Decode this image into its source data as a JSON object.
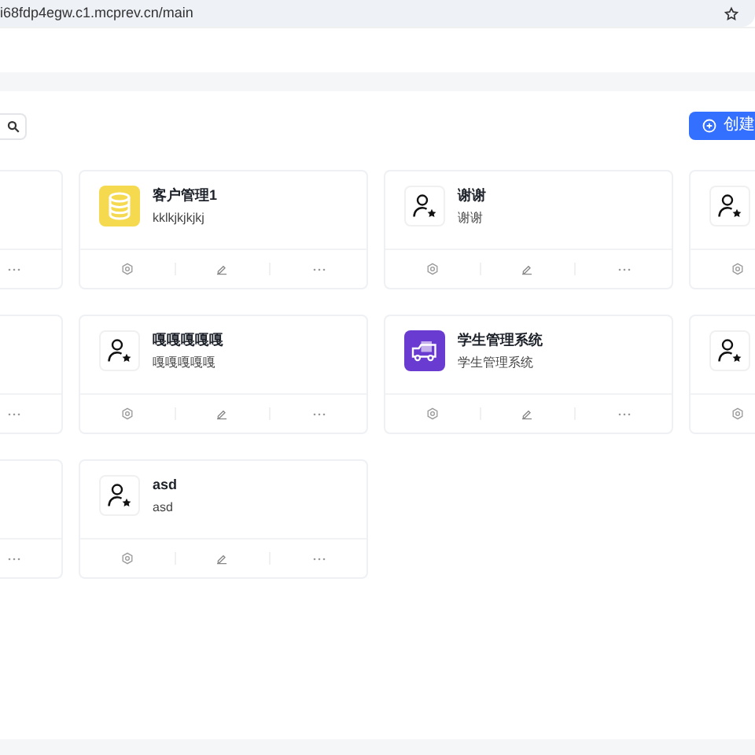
{
  "browser": {
    "url": "i68fdp4egw.c1.mcprev.cn/main"
  },
  "toolbar": {
    "create_button": "创建"
  },
  "cards": [
    {
      "kind": "blank"
    },
    {
      "kind": "database",
      "title": "客户管理1",
      "description": "kklkjkjkjkj"
    },
    {
      "kind": "user",
      "title": "谢谢",
      "description": "谢谢"
    },
    {
      "kind": "user"
    },
    {
      "kind": "blank"
    },
    {
      "kind": "user",
      "title": "嘎嘎嘎嘎嘎",
      "description": "嘎嘎嘎嘎嘎"
    },
    {
      "kind": "truck",
      "title": "学生管理系统",
      "description": "学生管理系统"
    },
    {
      "kind": "user"
    },
    {
      "kind": "blank"
    },
    {
      "kind": "user",
      "title": "asd",
      "description": "asd"
    }
  ]
}
